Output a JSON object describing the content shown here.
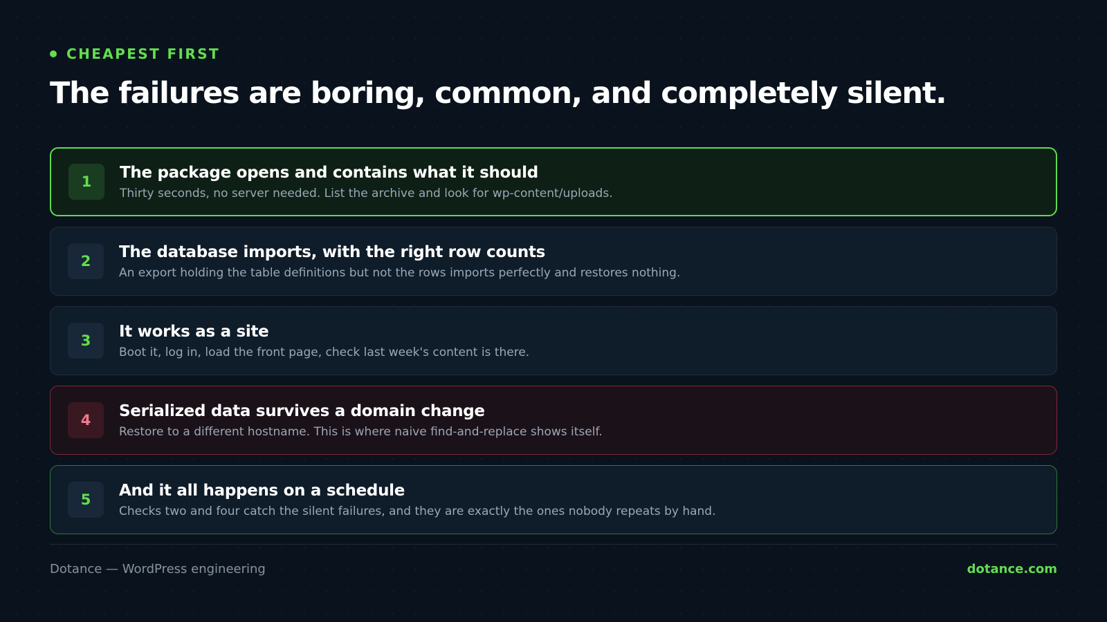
{
  "colors": {
    "background": "#0a131d",
    "accent": "#64dd4f",
    "danger": "#f07a8e",
    "danger_border": "#7e2838",
    "card_background": "#0f1c29",
    "muted_text": "#9ba8b6"
  },
  "header": {
    "eyebrow": "CHEAPEST FIRST",
    "eyebrow_icon": "bullet-dot-icon",
    "title": "The failures are boring, common, and completely silent."
  },
  "checks": [
    {
      "number": "1",
      "title": "The package opens and contains what it should",
      "description": "Thirty seconds, no server needed. List the archive and look for wp-content/uploads.",
      "state": "active"
    },
    {
      "number": "2",
      "title": "The database imports, with the right row counts",
      "description": "An export holding the table definitions but not the rows imports perfectly and restores nothing.",
      "state": "default"
    },
    {
      "number": "3",
      "title": "It works as a site",
      "description": "Boot it, log in, load the front page, check last week's content is there.",
      "state": "default"
    },
    {
      "number": "4",
      "title": "Serialized data survives a domain change",
      "description": "Restore to a different hostname. This is where naive find-and-replace shows itself.",
      "state": "danger"
    },
    {
      "number": "5",
      "title": "And it all happens on a schedule",
      "description": "Checks two and four catch the silent failures, and they are exactly the ones nobody repeats by hand.",
      "state": "success"
    }
  ],
  "footer": {
    "brand": "Dotance — WordPress engineering",
    "link": "dotance.com"
  }
}
